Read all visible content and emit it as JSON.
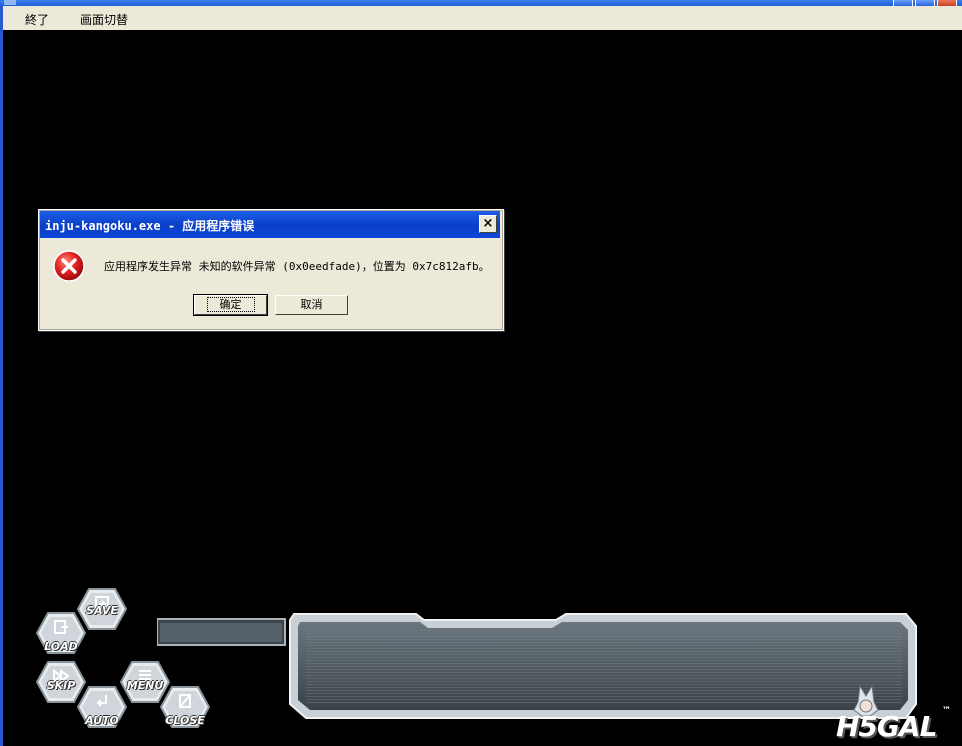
{
  "menu": {
    "items": [
      {
        "label": "終了"
      },
      {
        "label": "画面切替"
      }
    ]
  },
  "dialog": {
    "title": "inju-kangoku.exe - 应用程序错误",
    "message": "应用程序发生异常 未知的软件异常 (0x0eedfade)，位置为 0x7c812afb。",
    "ok_label": "确定",
    "cancel_label": "取消",
    "close_glyph": "×",
    "icon": "error-icon"
  },
  "game_controls": {
    "save": "SAVE",
    "load": "LOAD",
    "skip": "SKIP",
    "menu": "MENU",
    "auto": "AUTO",
    "close": "CLOSE"
  },
  "logo": {
    "text": "H5GAL",
    "tm": "™"
  },
  "colors": {
    "titlebar": "#0b3ec7",
    "dialog_bg": "#ece9d8",
    "error_red": "#d81e1e",
    "panel_steel": "#5a6670"
  }
}
